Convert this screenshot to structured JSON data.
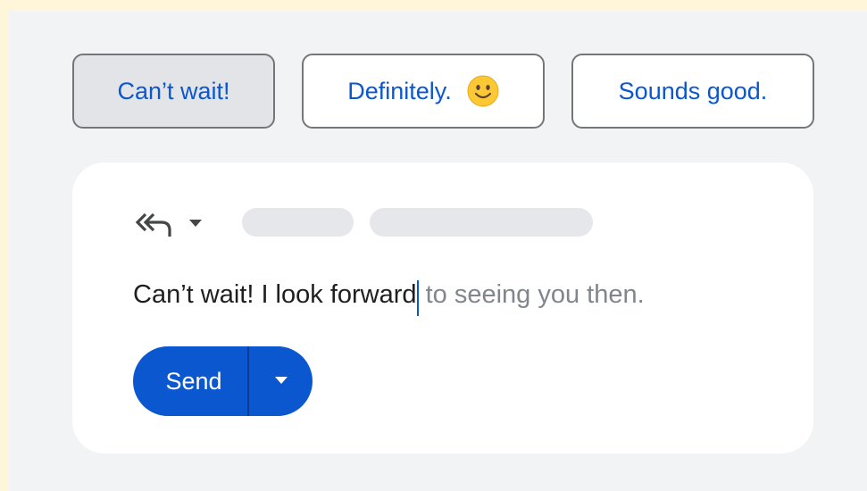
{
  "smart_replies": [
    {
      "label": "Can’t wait!",
      "selected": true
    },
    {
      "label": "Definitely.",
      "icon": "slightly-smiling-face-emoji"
    },
    {
      "label": "Sounds good."
    }
  ],
  "compose": {
    "reply_icon": "reply-all-icon",
    "reply_menu_icon": "caret-down-icon",
    "typed_text": "Can’t wait! I look forward",
    "suggested_text": " to seeing you then.",
    "send_label": "Send",
    "send_options_icon": "caret-down-icon"
  },
  "colors": {
    "background": "#fff5d9",
    "panel": "#f1f3f4",
    "accent": "#0b57d0",
    "suggestion_text": "#80868b",
    "selected_chip": "#e3e4e8"
  }
}
